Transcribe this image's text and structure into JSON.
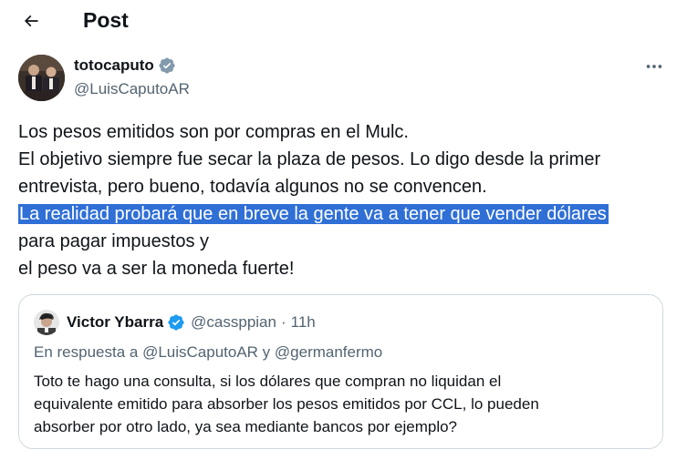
{
  "header": {
    "title": "Post"
  },
  "author": {
    "name": "totocaputo",
    "handle": "@LuisCaputoAR",
    "verified_badge_color": "#829aab"
  },
  "tweet": {
    "lines": [
      "Los pesos emitidos son por compras en el Mulc.",
      "El objetivo siempre fue secar la plaza de pesos. Lo digo desde la primer",
      "entrevista, pero bueno, todavía algunos no se convencen.",
      "La realidad probará que en breve la gente va a tener que vender dólares",
      "para pagar impuestos y",
      "el peso va a ser la moneda fuerte!"
    ],
    "highlight_color": "#2f6fd6"
  },
  "quoted_tweet": {
    "name": "Victor Ybarra",
    "handle": "@cassppian",
    "separator": "·",
    "time": "11h",
    "verified_badge_color": "#1d9bf0",
    "reply_to": "En respuesta a @LuisCaputoAR y @germanfermo",
    "body_lines": [
      "Toto te hago una consulta, si los dólares que compran no liquidan el",
      "equivalente emitido para absorber los pesos emitidos por CCL, lo pueden",
      "absorber por otro lado, ya sea mediante bancos por ejemplo?"
    ]
  },
  "icons": {
    "back": "back-arrow-icon",
    "more": "more-horizontal-icon",
    "verified": "verified-badge-icon"
  },
  "colors": {
    "text_primary": "#0f1419",
    "text_secondary": "#536471",
    "border": "#cfd9de"
  }
}
